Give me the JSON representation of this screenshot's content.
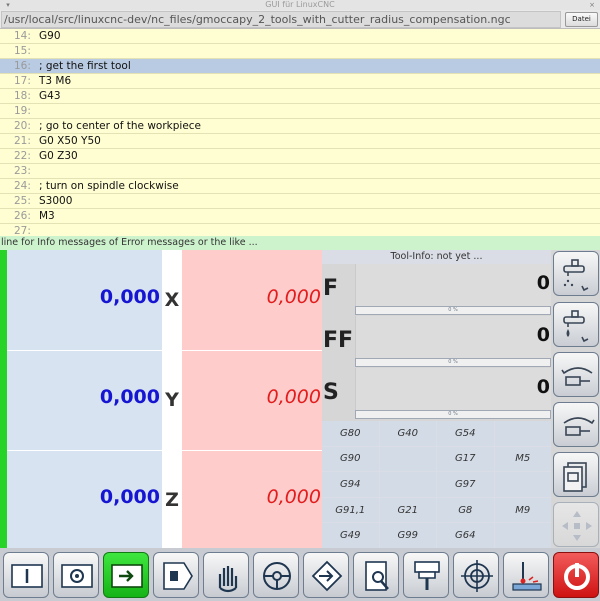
{
  "window": {
    "title": "GUI für LinuxCNC",
    "close_glyph": "×"
  },
  "file": {
    "path": "/usr/local/src/linuxcnc-dev/nc_files/gmoccapy_2_tools_with_cutter_radius_compensation.ngc",
    "button_label": "Datei"
  },
  "editor": {
    "lines": [
      {
        "number": "14:",
        "code": "G90"
      },
      {
        "number": "15:",
        "code": ""
      },
      {
        "number": "16:",
        "code": "; get the first tool",
        "current": true
      },
      {
        "number": "17:",
        "code": "T3 M6"
      },
      {
        "number": "18:",
        "code": "G43"
      },
      {
        "number": "19:",
        "code": ""
      },
      {
        "number": "20:",
        "code": "; go to center of the workpiece"
      },
      {
        "number": "21:",
        "code": "G0 X50 Y50"
      },
      {
        "number": "22:",
        "code": "G0 Z30"
      },
      {
        "number": "23:",
        "code": ""
      },
      {
        "number": "24:",
        "code": "; turn on spindle clockwise"
      },
      {
        "number": "25:",
        "code": "S3000"
      },
      {
        "number": "26:",
        "code": "M3"
      },
      {
        "number": "27:",
        "code": ""
      }
    ]
  },
  "info_line": "line for Info messages of Error messages or the like ...",
  "dro": [
    {
      "axis": "X",
      "absolute": "0,000",
      "dtg": "0,000"
    },
    {
      "axis": "Y",
      "absolute": "0,000",
      "dtg": "0,000"
    },
    {
      "axis": "Z",
      "absolute": "0,000",
      "dtg": "0,000"
    }
  ],
  "tool_info": "Tool-Info:  not yet ...",
  "speeds": [
    {
      "label": "F",
      "value": "0",
      "bar": "0 %"
    },
    {
      "label": "FF",
      "value": "0",
      "bar": "0 %"
    },
    {
      "label": "S",
      "value": "0",
      "bar": "0 %"
    }
  ],
  "gcodes": [
    "G80",
    "G40",
    "G54",
    "",
    "G90",
    "",
    "G17",
    "M5",
    "G94",
    "",
    "G97",
    "",
    "G91,1",
    "G21",
    "G8",
    "M9",
    "G49",
    "G99",
    "G64",
    ""
  ],
  "right_buttons": [
    {
      "icon": "coolant-mist-icon"
    },
    {
      "icon": "coolant-flood-icon"
    },
    {
      "icon": "spindle-ccw-icon"
    },
    {
      "icon": "spindle-cw-icon"
    },
    {
      "icon": "document-icon"
    },
    {
      "icon": "jog-arrows-icon",
      "disabled": true
    }
  ],
  "bottom_buttons": [
    {
      "icon": "manual-mode-icon"
    },
    {
      "icon": "home-icon"
    },
    {
      "icon": "auto-mode-icon",
      "active": true
    },
    {
      "icon": "mdi-icon"
    },
    {
      "icon": "hand-icon"
    },
    {
      "icon": "steering-wheel-icon"
    },
    {
      "icon": "touch-off-icon"
    },
    {
      "icon": "edit-icon"
    },
    {
      "icon": "tool-change-icon"
    },
    {
      "icon": "target-icon"
    },
    {
      "icon": "probe-icon"
    },
    {
      "icon": "power-icon",
      "color": "red"
    }
  ],
  "colors": {
    "accent_green": "#27d327",
    "dro_abs_text": "#1515d2",
    "dro_dtg_text": "#e31c1c",
    "editor_bg": "#fffed2",
    "current_line": "#b8cbe2"
  }
}
